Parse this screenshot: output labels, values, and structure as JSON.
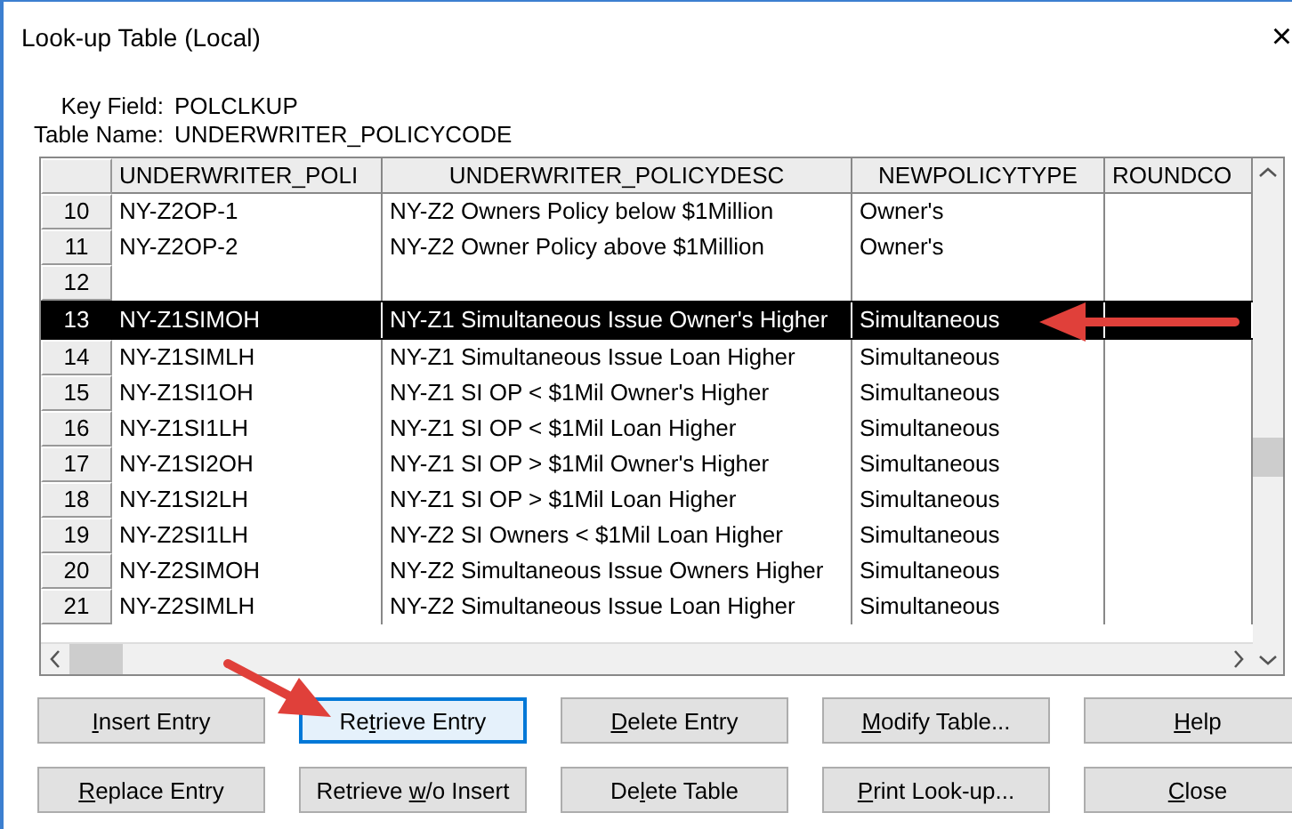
{
  "window": {
    "title": "Look-up Table (Local)",
    "close": "×"
  },
  "info": [
    {
      "label": "Key Field:",
      "value": "POLCLKUP"
    },
    {
      "label": "Table Name:",
      "value": "UNDERWRITER_POLICYCODE"
    }
  ],
  "table": {
    "columns": [
      "UNDERWRITER_POLI",
      "UNDERWRITER_POLICYDESC",
      "NEWPOLICYTYPE",
      "ROUNDCO"
    ],
    "rows": [
      {
        "number": "10",
        "cells": [
          "NY-Z2OP-1",
          "NY-Z2 Owners Policy below $1Million",
          "Owner's",
          ""
        ],
        "selected": false
      },
      {
        "number": "11",
        "cells": [
          "NY-Z2OP-2",
          "NY-Z2 Owner Policy above $1Million",
          "Owner's",
          ""
        ],
        "selected": false
      },
      {
        "number": "12",
        "cells": [
          "",
          "",
          "",
          ""
        ],
        "selected": false
      },
      {
        "number": "13",
        "cells": [
          "NY-Z1SIMOH",
          "NY-Z1 Simultaneous Issue Owner's Higher",
          "Simultaneous",
          ""
        ],
        "selected": true
      },
      {
        "number": "14",
        "cells": [
          "NY-Z1SIMLH",
          "NY-Z1 Simultaneous Issue Loan Higher",
          "Simultaneous",
          ""
        ],
        "selected": false
      },
      {
        "number": "15",
        "cells": [
          "NY-Z1SI1OH",
          "NY-Z1 SI OP < $1Mil Owner's Higher",
          "Simultaneous",
          ""
        ],
        "selected": false
      },
      {
        "number": "16",
        "cells": [
          "NY-Z1SI1LH",
          "NY-Z1 SI OP < $1Mil Loan Higher",
          "Simultaneous",
          ""
        ],
        "selected": false
      },
      {
        "number": "17",
        "cells": [
          "NY-Z1SI2OH",
          "NY-Z1 SI OP > $1Mil Owner's Higher",
          "Simultaneous",
          ""
        ],
        "selected": false
      },
      {
        "number": "18",
        "cells": [
          "NY-Z1SI2LH",
          "NY-Z1 SI OP > $1Mil Loan Higher",
          "Simultaneous",
          ""
        ],
        "selected": false
      },
      {
        "number": "19",
        "cells": [
          "NY-Z2SI1LH",
          "NY-Z2 SI Owners < $1Mil Loan Higher",
          "Simultaneous",
          ""
        ],
        "selected": false
      },
      {
        "number": "20",
        "cells": [
          "NY-Z2SIMOH",
          "NY-Z2 Simultaneous Issue Owners Higher",
          "Simultaneous",
          ""
        ],
        "selected": false
      },
      {
        "number": "21",
        "cells": [
          "NY-Z2SIMLH",
          "NY-Z2 Simultaneous Issue Loan Higher",
          "Simultaneous",
          ""
        ],
        "selected": false
      }
    ]
  },
  "buttons": [
    {
      "access_key": "I",
      "after": "nsert Entry",
      "focused": false
    },
    {
      "before": "Re",
      "access_key": "t",
      "after": "rieve Entry",
      "focused": true
    },
    {
      "access_key": "D",
      "after": "elete Entry",
      "focused": false
    },
    {
      "access_key": "M",
      "after": "odify Table...",
      "focused": false
    },
    {
      "access_key": "H",
      "after": "elp",
      "focused": false
    },
    {
      "access_key": "R",
      "after": "eplace Entry",
      "focused": false
    },
    {
      "before": "Retrieve ",
      "access_key": "w",
      "after": "/o Insert",
      "focused": false
    },
    {
      "before": "De",
      "access_key": "l",
      "after": "ete Table",
      "focused": false
    },
    {
      "access_key": "P",
      "after": "rint Look-up...",
      "focused": false
    },
    {
      "access_key": "C",
      "after": "lose",
      "focused": false
    }
  ]
}
